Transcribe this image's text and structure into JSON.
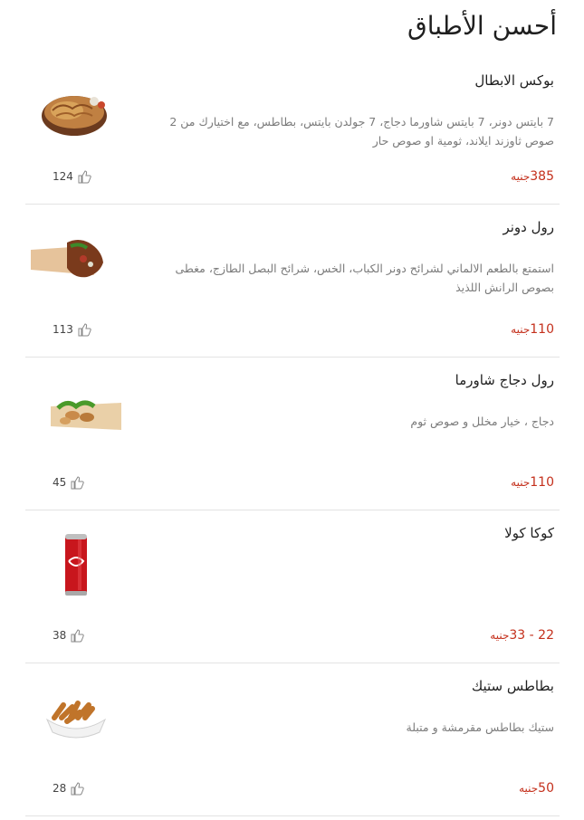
{
  "section_title": "أحسن الأطباق",
  "currency": "جنيه",
  "items": [
    {
      "name": "بوكس الابطال",
      "description": "7 بايتس دونر، 7 بايتس شاورما دجاج، 7 جولدن بايتس، بطاطس، مع اختيارك من 2 صوص ثاوزند ايلاند، ثومية او صوص حار",
      "price": "385",
      "likes": "124",
      "image_icon": "food-platter-icon"
    },
    {
      "name": "رول دونر",
      "description": "استمتع بالطعم الالماني لشرائح دونر الكباب، الخس، شرائح البصل الطازج، مغطى بصوص الرانش اللذيذ",
      "price": "110",
      "likes": "113",
      "image_icon": "wrap-roll-icon"
    },
    {
      "name": "رول دجاج شاورما",
      "description": "دجاج ، خيار مخلل و صوص ثوم",
      "price": "110",
      "likes": "45",
      "image_icon": "chicken-wrap-icon"
    },
    {
      "name": "كوكا كولا",
      "description": "",
      "price": "22 - 33",
      "likes": "38",
      "image_icon": "soda-can-icon"
    },
    {
      "name": "بطاطس ستيك",
      "description": "ستيك بطاطس مقرمشة و متبلة",
      "price": "50",
      "likes": "28",
      "image_icon": "fries-bowl-icon"
    }
  ],
  "colors": {
    "price": "#c4301c",
    "text": "#1f1f1f",
    "muted": "#7b7b7b",
    "divider": "#e3e3e3"
  }
}
